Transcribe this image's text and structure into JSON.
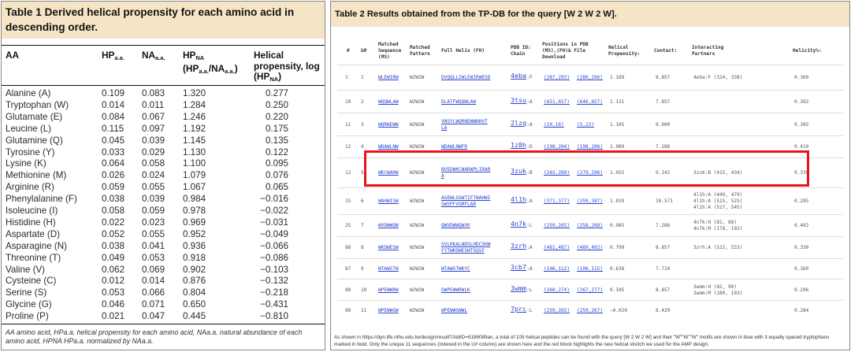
{
  "table1": {
    "title": "Table 1 Derived helical propensity for each amino acid in descending order.",
    "headers": {
      "aa": "AA",
      "hp": "HP",
      "hp_sub": "a.a.",
      "na": "NA",
      "na_sub": "a.a.",
      "hpna": "HP",
      "hpna_sub": "NA",
      "hpna_paren_open": "(HP",
      "hpna_paren_sub1": "a.a.",
      "hpna_paren_mid": "/NA",
      "hpna_paren_sub2": "a.a.",
      "hpna_paren_close": ")",
      "helical_line1": "Helical",
      "helical_line2": "propensity, log",
      "helical_line3": "(HP",
      "helical_line3_sub": "NA",
      "helical_line3_close": ")"
    },
    "rows": [
      [
        "Alanine (A)",
        "0.109",
        "0.083",
        "1.320",
        "0.277"
      ],
      [
        "Tryptophan (W)",
        "0.014",
        "0.011",
        "1.284",
        "0.250"
      ],
      [
        "Glutamate (E)",
        "0.084",
        "0.067",
        "1.246",
        "0.220"
      ],
      [
        "Leucine (L)",
        "0.115",
        "0.097",
        "1.192",
        "0.175"
      ],
      [
        "Glutamine (Q)",
        "0.045",
        "0.039",
        "1.145",
        "0.135"
      ],
      [
        "Tyrosine (Y)",
        "0.033",
        "0.029",
        "1.130",
        "0.122"
      ],
      [
        "Lysine (K)",
        "0.064",
        "0.058",
        "1.100",
        "0.095"
      ],
      [
        "Methionine (M)",
        "0.026",
        "0.024",
        "1.079",
        "0.076"
      ],
      [
        "Arginine (R)",
        "0.059",
        "0.055",
        "1.067",
        "0.065"
      ],
      [
        "Phenylalanine (F)",
        "0.038",
        "0.039",
        "0.984",
        "−0.016"
      ],
      [
        "Isoleucine (I)",
        "0.058",
        "0.059",
        "0.978",
        "−0.022"
      ],
      [
        "Histidine (H)",
        "0.022",
        "0.023",
        "0.969",
        "−0.031"
      ],
      [
        "Aspartate (D)",
        "0.052",
        "0.055",
        "0.952",
        "−0.049"
      ],
      [
        "Asparagine (N)",
        "0.038",
        "0.041",
        "0.936",
        "−0.066"
      ],
      [
        "Threonine (T)",
        "0.049",
        "0.053",
        "0.918",
        "−0.086"
      ],
      [
        "Valine (V)",
        "0.062",
        "0.069",
        "0.902",
        "−0.103"
      ],
      [
        "Cysteine (C)",
        "0.012",
        "0.014",
        "0.876",
        "−0.132"
      ],
      [
        "Serine (S)",
        "0.053",
        "0.066",
        "0.804",
        "−0.218"
      ],
      [
        "Glycine (G)",
        "0.046",
        "0.071",
        "0.650",
        "−0.431"
      ],
      [
        "Proline (P)",
        "0.021",
        "0.047",
        "0.445",
        "−0.810"
      ]
    ],
    "footnote": "AA amino acid, HPa.a. helical propensity for each amino acid, NAa.a. natural abundance of each amino acid, HPNA HPa.a. normalized by NAa.a."
  },
  "table2": {
    "title": "Table 2 Results obtained from the TP-DB for the query [W 2 W 2 W].",
    "headers": {
      "num": "#",
      "u": "U#",
      "matched_seq": [
        "Matched",
        "Sequence",
        "(MS)"
      ],
      "matched_pat": [
        "Matched",
        "Pattern"
      ],
      "full_helix": "Full Helix (FH)",
      "pdb": [
        "PDB ID:",
        "Chain"
      ],
      "positions": [
        "Positions in PDB",
        "(MS),(FH)& File",
        "Download"
      ],
      "helical": [
        "Helical",
        "Propensity:"
      ],
      "contact": "Contact:",
      "interacting": [
        "Interacting",
        "Partners"
      ],
      "helicity": "Helicity%:"
    },
    "rows": [
      {
        "n": "1",
        "u": "1",
        "ms": "WLEWIRW",
        "pat": "W2W2W",
        "fh": [
          "DVQQLLIWLEWIRWESD"
        ],
        "pdb": "4eba",
        "chain": ":F",
        "pos1": "(287,293)",
        "pos2": "(280,296)",
        "hp": "1.189",
        "contact": "8.857",
        "partners": [
          "4eba:F (324, 338)"
        ],
        "helicity": "0.360"
      },
      {
        "n": "10",
        "u": "2",
        "ms": "WQQWLAW",
        "pat": "W2W2W",
        "fh": [
          "DLATFWQQWLAW"
        ],
        "pdb": "3tsu",
        "chain": ":A",
        "pos1": "(651,657)",
        "pos2": "(646,657)",
        "hp": "1.131",
        "contact": "7.857",
        "partners": [],
        "helicity": "0.392"
      },
      {
        "n": "11",
        "u": "3",
        "ms": "WQRNEWW",
        "pat": "W2W2W",
        "fh": [
          "VNSYLWQRNEWWNHVT",
          "LA"
        ],
        "pdb": "2lzq",
        "chain": ":A",
        "pos1": "(10,16)",
        "pos2": "(5,23)",
        "hp": "1.105",
        "contact": "8.000",
        "partners": [],
        "helicity": "0.385"
      },
      {
        "n": "12",
        "u": "4",
        "ms": "WDAWLNW",
        "pat": "W2W2W",
        "fh": [
          "WDAWLNWFR"
        ],
        "pdb": "1z8h",
        "chain": ":D",
        "pos1": "(198,204)",
        "pos2": "(198,206)",
        "hp": "1.089",
        "contact": "7.286",
        "partners": [],
        "helicity": "0.410"
      },
      {
        "n": "13",
        "u": "5",
        "ms": "WKCWARW",
        "pat": "W2W2W",
        "fh": [
          "NVEDWKCWARWPLIRAR",
          "A"
        ],
        "pdb": "3zuk",
        "chain": ":B",
        "pos1": "(283,289)",
        "pos2": "(279,296)",
        "hp": "1.055",
        "contact": "9.143",
        "partners": [
          "3zuk:B (415, 434)"
        ],
        "helicity": "0.339"
      },
      {
        "n": "15",
        "u": "6",
        "ms": "WAHWISW",
        "pat": "W2W2W",
        "fh": [
          "AGEWLGSWTIFTWAHWI",
          "SWSPFVGMFLAR"
        ],
        "pdb": "4l1h",
        "chain": ":A",
        "pos1": "(371,377)",
        "pos2": "(359,387)",
        "hp": "1.039",
        "contact": "10.571",
        "partners": [
          "4l1h:A (449, 479)",
          "4l1h:A (515, 525)",
          "4l1h:A (527, 545)"
        ],
        "helicity": "0.285"
      },
      {
        "n": "25",
        "u": "7",
        "ms": "WVDWWQW",
        "pat": "W2W2W",
        "fh": [
          "QWVDWWQWVK"
        ],
        "pdb": "4n7k",
        "chain": ":L",
        "pos1": "(259,265)",
        "pos2": "(258,268)",
        "hp": "0.985",
        "contact": "7.286",
        "partners": [
          "4n7k:H (81, 88)",
          "4n7k:M (178, 192)"
        ],
        "helicity": "0.402"
      },
      {
        "n": "86",
        "u": "8",
        "ms": "WKDWESW",
        "pat": "W2W2W",
        "fh": [
          "SVLRKALNDSLHDCSHW",
          "FYTWKDWESWTSQSF"
        ],
        "pdb": "3zrh",
        "chain": ":A",
        "pos1": "(481,487)",
        "pos2": "(460,492)",
        "hp": "0.799",
        "contact": "8.857",
        "partners": [
          "3zrh:A (522, 533)"
        ],
        "helicity": "0.330"
      },
      {
        "n": "87",
        "u": "9",
        "ms": "WTAWSTW",
        "pat": "W2W2W",
        "fh": [
          "WTAWSTWKYC"
        ],
        "pdb": "3cb7",
        "chain": ":A",
        "pos1": "(106,112)",
        "pos2": "(106,115)",
        "hp": "0.638",
        "contact": "7.714",
        "partners": [],
        "helicity": "0.360"
      },
      {
        "n": "88",
        "u": "10",
        "ms": "WPEWWRW",
        "pat": "W2W2W",
        "fh": [
          "GWPEWWRWLK"
        ],
        "pdb": "3wmm",
        "chain": ":L",
        "pos1": "(268,274)",
        "pos2": "(267,277)",
        "hp": "0.345",
        "contact": "8.857",
        "partners": [
          "3wmm:H (82, 90)",
          "3wmm:M (180, 193)"
        ],
        "helicity": "0.296"
      },
      {
        "n": "89",
        "u": "11",
        "ms": "WPEWWGW",
        "pat": "W2W2W",
        "fh": [
          "WPEWWGWWL"
        ],
        "pdb": "7prc",
        "chain": ":L",
        "pos1": "(259,265)",
        "pos2": "(259,267)",
        "hp": "−0.020",
        "contact": "8.429",
        "partners": [],
        "helicity": "0.284"
      }
    ],
    "footnote": "As shown in https://dyn.life.nthu.edu.tw/design/result?JobID=6186089an, a total of 105 helical peptides can be found with the query [W 2 W 2 W] and their \"W\"\"W\"\"W\" motifs are shown in blue with 3 equally spaced tryptophans marked in bold. Only the unique 11 sequences (indexed in the U# column) are shown here and the red block highlights the new helical stretch we used for the AMP design."
  },
  "colors": {
    "title_bg": "#f5e5c6",
    "link": "#2b44cc",
    "highlight": "#e8141b"
  }
}
